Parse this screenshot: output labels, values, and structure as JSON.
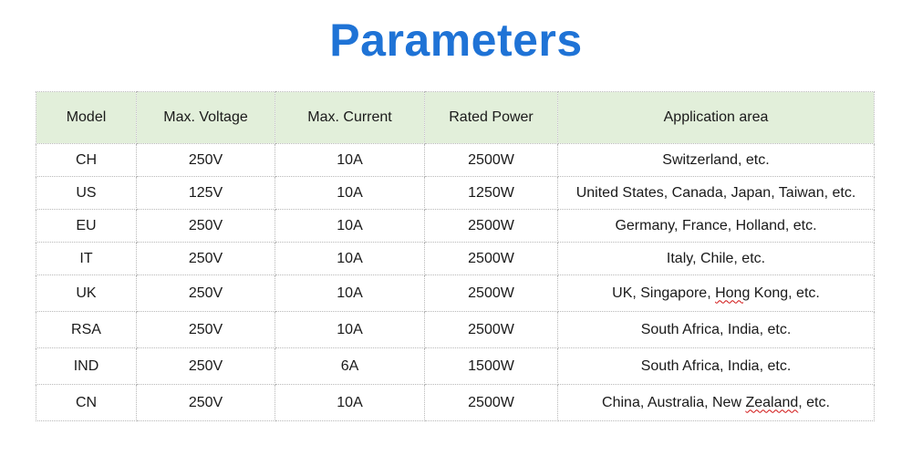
{
  "page": {
    "title": "Parameters",
    "title_color": "#1f73d6",
    "header_bg": "#e2efda"
  },
  "table": {
    "headers": [
      "Model",
      "Max. Voltage",
      "Max. Current",
      "Rated Power",
      "Application area"
    ],
    "rows": [
      [
        "CH",
        "250V",
        "10A",
        "2500W",
        "Switzerland, etc."
      ],
      [
        "US",
        "125V",
        "10A",
        "1250W",
        "United States, Canada, Japan, Taiwan, etc."
      ],
      [
        "EU",
        "250V",
        "10A",
        "2500W",
        "Germany, France, Holland, etc."
      ],
      [
        "IT",
        "250V",
        "10A",
        "2500W",
        "Italy, Chile, etc."
      ],
      [
        "UK",
        "250V",
        "10A",
        "2500W",
        "UK, Singapore, Hong Kong, etc."
      ],
      [
        "RSA",
        "250V",
        "10A",
        "2500W",
        "South Africa, India, etc."
      ],
      [
        "IND",
        "250V",
        "6A",
        "1500W",
        "South Africa, India, etc."
      ],
      [
        "CN",
        "250V",
        "10A",
        "2500W",
        "China, Australia, New Zealand, etc."
      ]
    ]
  }
}
